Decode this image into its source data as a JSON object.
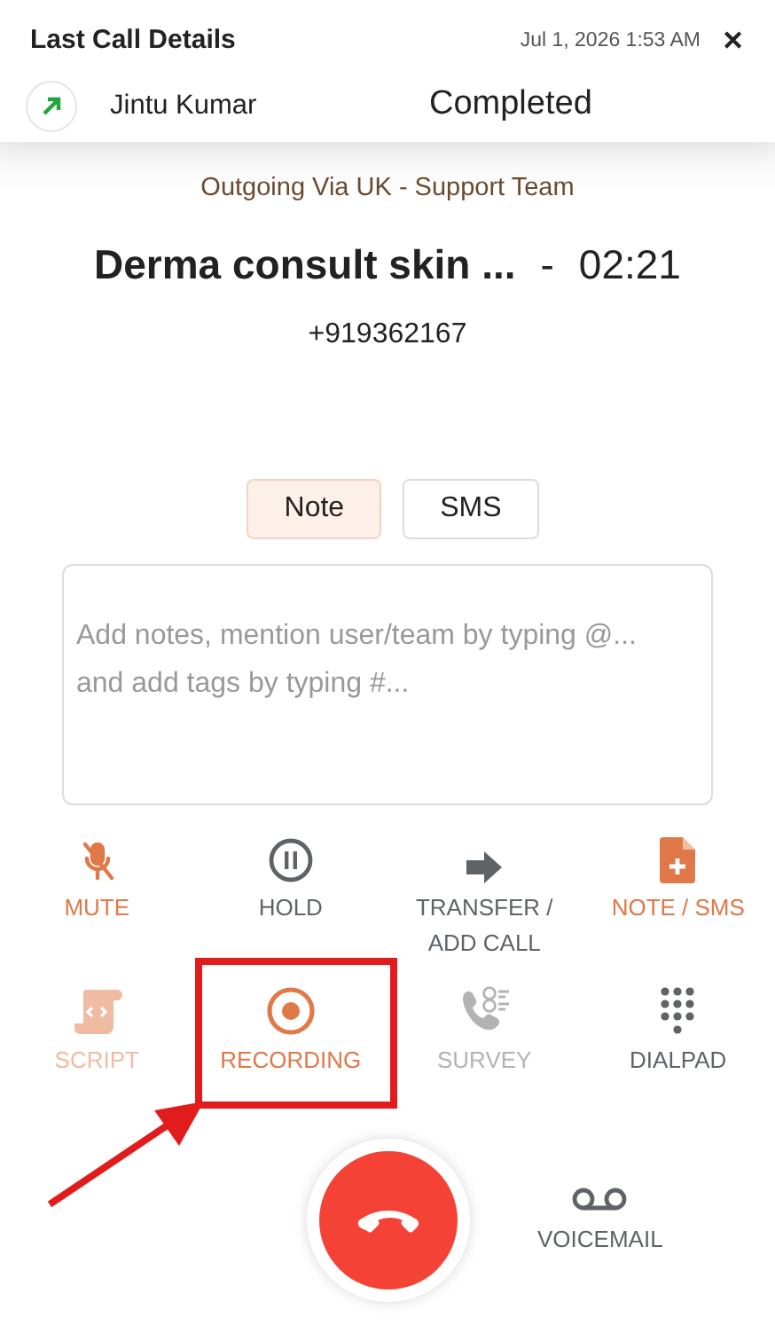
{
  "header": {
    "title": "Last Call Details",
    "timestamp": "Jul 1, 2026 1:53 AM",
    "close": "✕"
  },
  "call": {
    "contact": "Jintu Kumar",
    "status": "Completed",
    "route": "Outgoing Via UK - Support Team",
    "subject": "Derma consult skin ...",
    "separator": "-",
    "duration": "02:21",
    "number": "+919362167"
  },
  "tabs": [
    {
      "label": "Note",
      "selected": true
    },
    {
      "label": "SMS",
      "selected": false
    }
  ],
  "notes": {
    "placeholder": "Add notes, mention user/team by typing @... and add tags by typing #..."
  },
  "actions": [
    {
      "kind": "mute",
      "label": "MUTE",
      "color": "#e07848",
      "highlighted": false
    },
    {
      "kind": "hold",
      "label": "HOLD",
      "color": "#5f6368",
      "highlighted": false
    },
    {
      "kind": "transfer",
      "label": "TRANSFER / ADD CALL",
      "color": "#5f6368",
      "highlighted": false
    },
    {
      "kind": "note",
      "label": "NOTE / SMS",
      "color": "#e07848",
      "highlighted": false
    },
    {
      "kind": "script",
      "label": "SCRIPT",
      "color": "#efbba3",
      "highlighted": false
    },
    {
      "kind": "recording",
      "label": "RECORDING",
      "color": "#e07848",
      "highlighted": true
    },
    {
      "kind": "survey",
      "label": "SURVEY",
      "color": "#b3b3b3",
      "highlighted": false
    },
    {
      "kind": "dialpad",
      "label": "DIALPAD",
      "color": "#5f6368",
      "highlighted": false
    }
  ],
  "voicemail": {
    "label": "VOICEMAIL"
  }
}
